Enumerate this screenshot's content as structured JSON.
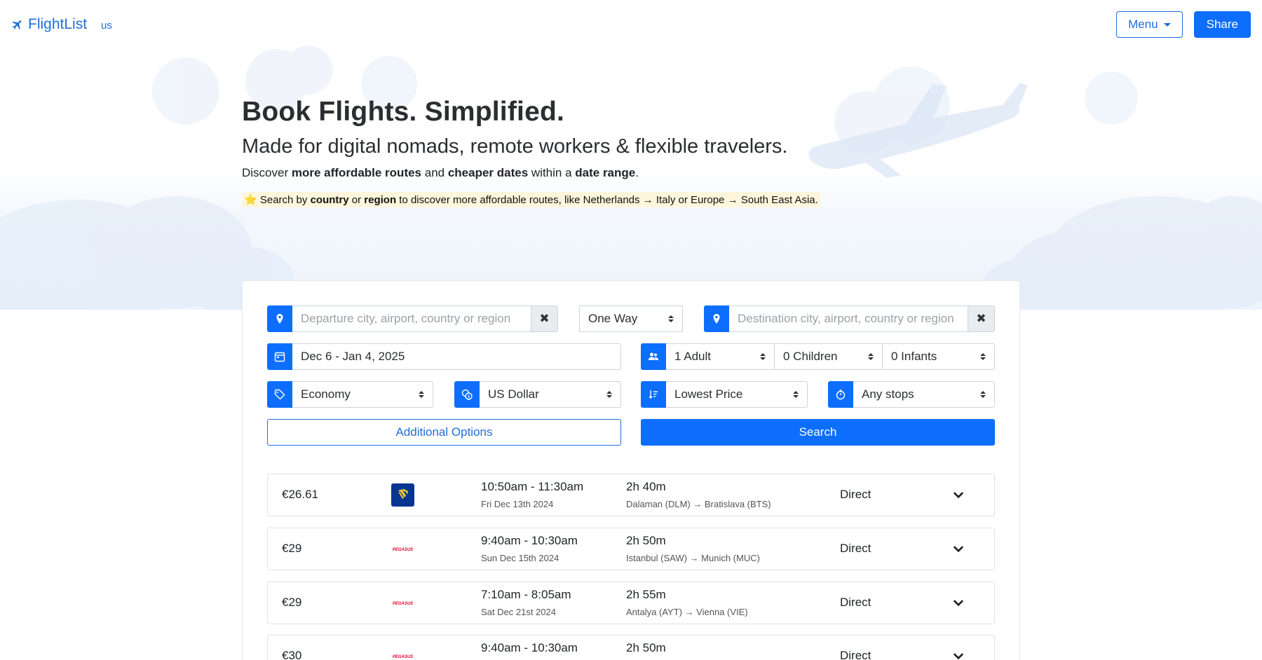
{
  "header": {
    "brand": "FlightList",
    "region": "us",
    "menu_label": "Menu",
    "share_label": "Share"
  },
  "hero": {
    "title": "Book Flights. Simplified.",
    "subtitle": "Made for digital nomads, remote workers & flexible travelers.",
    "lead": {
      "p1": "Discover ",
      "b1": "more affordable routes",
      "p2": " and ",
      "b2": "cheaper dates",
      "p3": " within a ",
      "b3": "date range",
      "p4": "."
    },
    "tip": {
      "star": "⭐",
      "p1": " Search by ",
      "b1": "country",
      "p2": " or ",
      "b2": "region",
      "p3": " to discover more affordable routes, like Netherlands → Italy or Europe → South East Asia."
    }
  },
  "search": {
    "departure_placeholder": "Departure city, airport, country or region",
    "trip_type": "One Way",
    "destination_placeholder": "Destination city, airport, country or region",
    "date_range": "Dec 6 - Jan 4, 2025",
    "adults": "1 Adult",
    "children": "0 Children",
    "infants": "0 Infants",
    "cabin": "Economy",
    "currency": "US Dollar",
    "sort": "Lowest Price",
    "stops": "Any stops",
    "additional_label": "Additional Options",
    "search_label": "Search"
  },
  "results": [
    {
      "price": "€26.61",
      "airline": "ryanair-logo",
      "times": "10:50am - 11:30am",
      "date": "Fri Dec 13th 2024",
      "duration": "2h 40m",
      "route": "Dalaman (DLM) → Bratislava (BTS)",
      "stops": "Direct"
    },
    {
      "price": "€29",
      "airline": "pegasus-logo",
      "times": "9:40am - 10:30am",
      "date": "Sun Dec 15th 2024",
      "duration": "2h 50m",
      "route": "Istanbul (SAW) → Munich (MUC)",
      "stops": "Direct"
    },
    {
      "price": "€29",
      "airline": "pegasus-logo",
      "times": "7:10am - 8:05am",
      "date": "Sat Dec 21st 2024",
      "duration": "2h 55m",
      "route": "Antalya (AYT) → Vienna (VIE)",
      "stops": "Direct"
    },
    {
      "price": "€30",
      "airline": "pegasus-logo",
      "times": "9:40am - 10:30am",
      "date": "",
      "duration": "2h 50m",
      "route": "",
      "stops": "Direct"
    }
  ],
  "colors": {
    "primary": "#0d6efd",
    "link": "#1f6fd9",
    "tip_bg": "#fdf6dc",
    "ryanair_bg": "#073590",
    "pegasus_red": "#e4002b"
  }
}
